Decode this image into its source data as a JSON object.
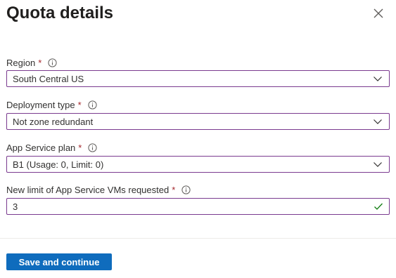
{
  "header": {
    "title": "Quota details",
    "close_icon": "close-icon"
  },
  "form": {
    "required_marker": "*",
    "info_icon": "info-icon",
    "accent_color": "#7a3a8f",
    "region": {
      "label": "Region",
      "value": "South Central US"
    },
    "deployment_type": {
      "label": "Deployment type",
      "value": "Not zone redundant"
    },
    "app_service_plan": {
      "label": "App Service plan",
      "value": "B1 (Usage: 0, Limit: 0)"
    },
    "new_limit": {
      "label": "New limit of App Service VMs requested",
      "value": "3",
      "valid_icon": "checkmark-icon",
      "valid_color": "#107c10"
    }
  },
  "footer": {
    "primary_button_label": "Save and continue",
    "primary_button_color": "#0f6cbd"
  }
}
